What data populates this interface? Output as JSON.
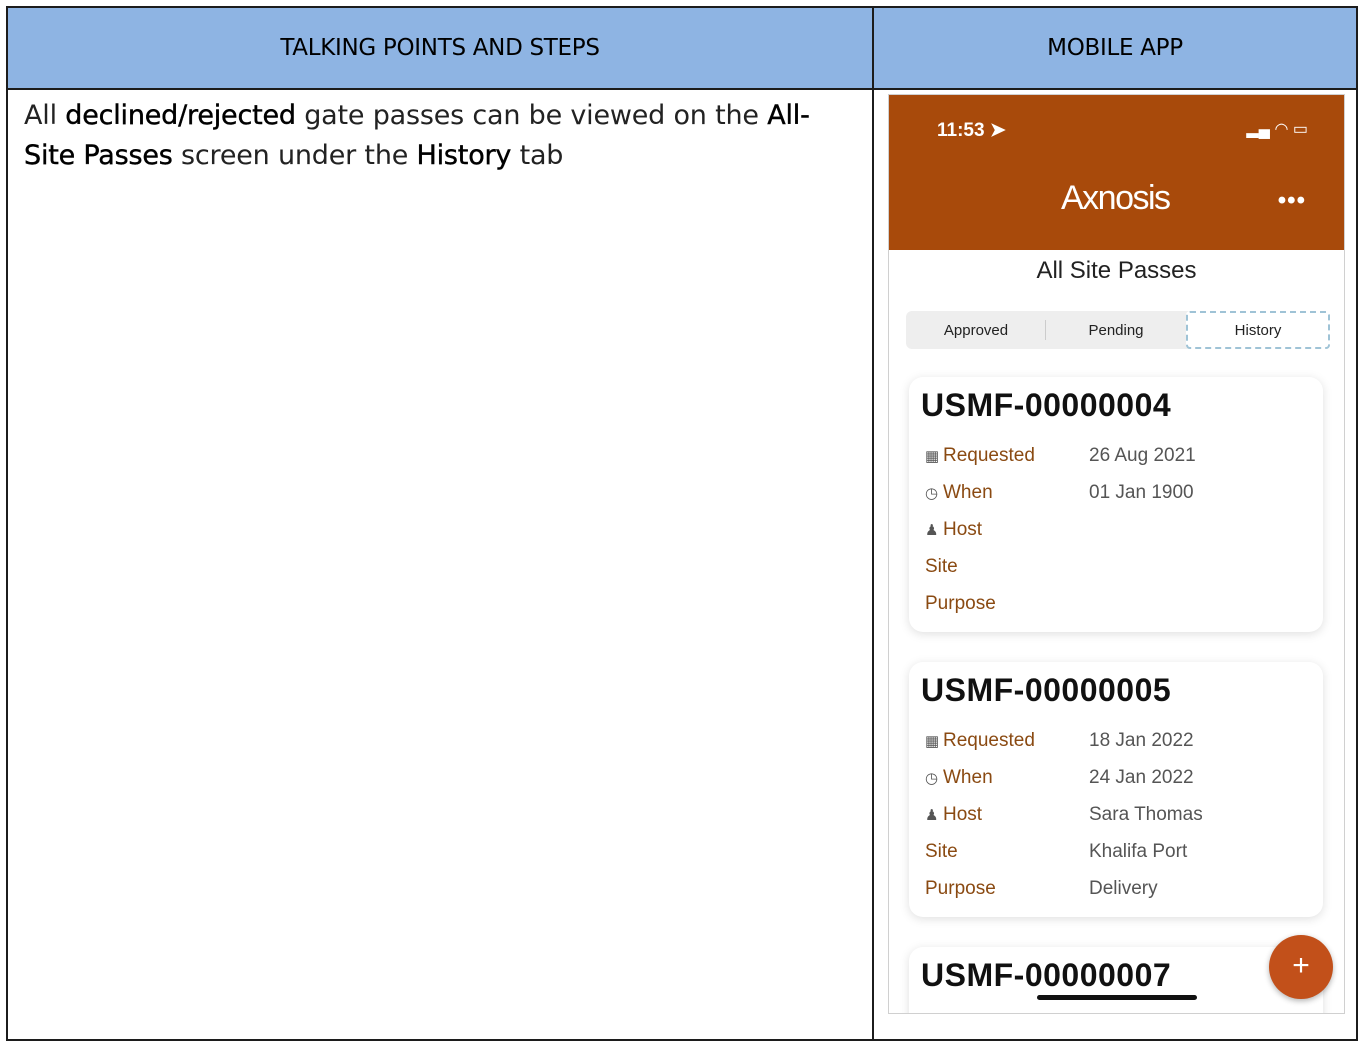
{
  "table": {
    "col_left_header": "TALKING POINTS AND STEPS",
    "col_right_header": "MOBILE APP"
  },
  "step": {
    "t1": "All ",
    "b1": "declined/rejected",
    "t2": " gate passes can be viewed on the ",
    "b2": "All-Site Passes",
    "t3": " screen under the ",
    "b3": "History",
    "t4": " tab"
  },
  "phone": {
    "time": "11:53",
    "logo": "Axnosis",
    "screen_title": "All Site Passes",
    "tabs": [
      "Approved",
      "Pending",
      "History"
    ],
    "active_tab": "History",
    "labels": {
      "requested": "Requested",
      "when": "When",
      "host": "Host",
      "site": "Site",
      "purpose": "Purpose"
    },
    "cards": [
      {
        "id": "USMF-00000004",
        "requested": "26 Aug 2021",
        "when": "01 Jan 1900",
        "host": "",
        "site": "",
        "purpose": ""
      },
      {
        "id": "USMF-00000005",
        "requested": "18 Jan 2022",
        "when": "24 Jan 2022",
        "host": "Sara Thomas",
        "site": "Khalifa Port",
        "purpose": "Delivery"
      },
      {
        "id": "USMF-00000007"
      }
    ],
    "fab_label": "+"
  }
}
